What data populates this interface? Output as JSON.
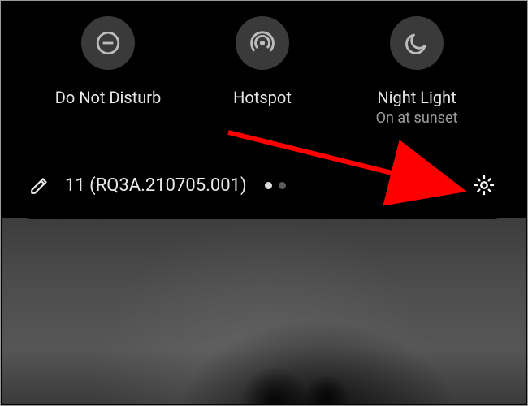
{
  "tiles": [
    {
      "label": "Do Not Disturb",
      "sub": ""
    },
    {
      "label": "Hotspot",
      "sub": ""
    },
    {
      "label": "Night Light",
      "sub": "On at sunset"
    }
  ],
  "footer": {
    "build": "11 (RQ3A.210705.001)"
  }
}
